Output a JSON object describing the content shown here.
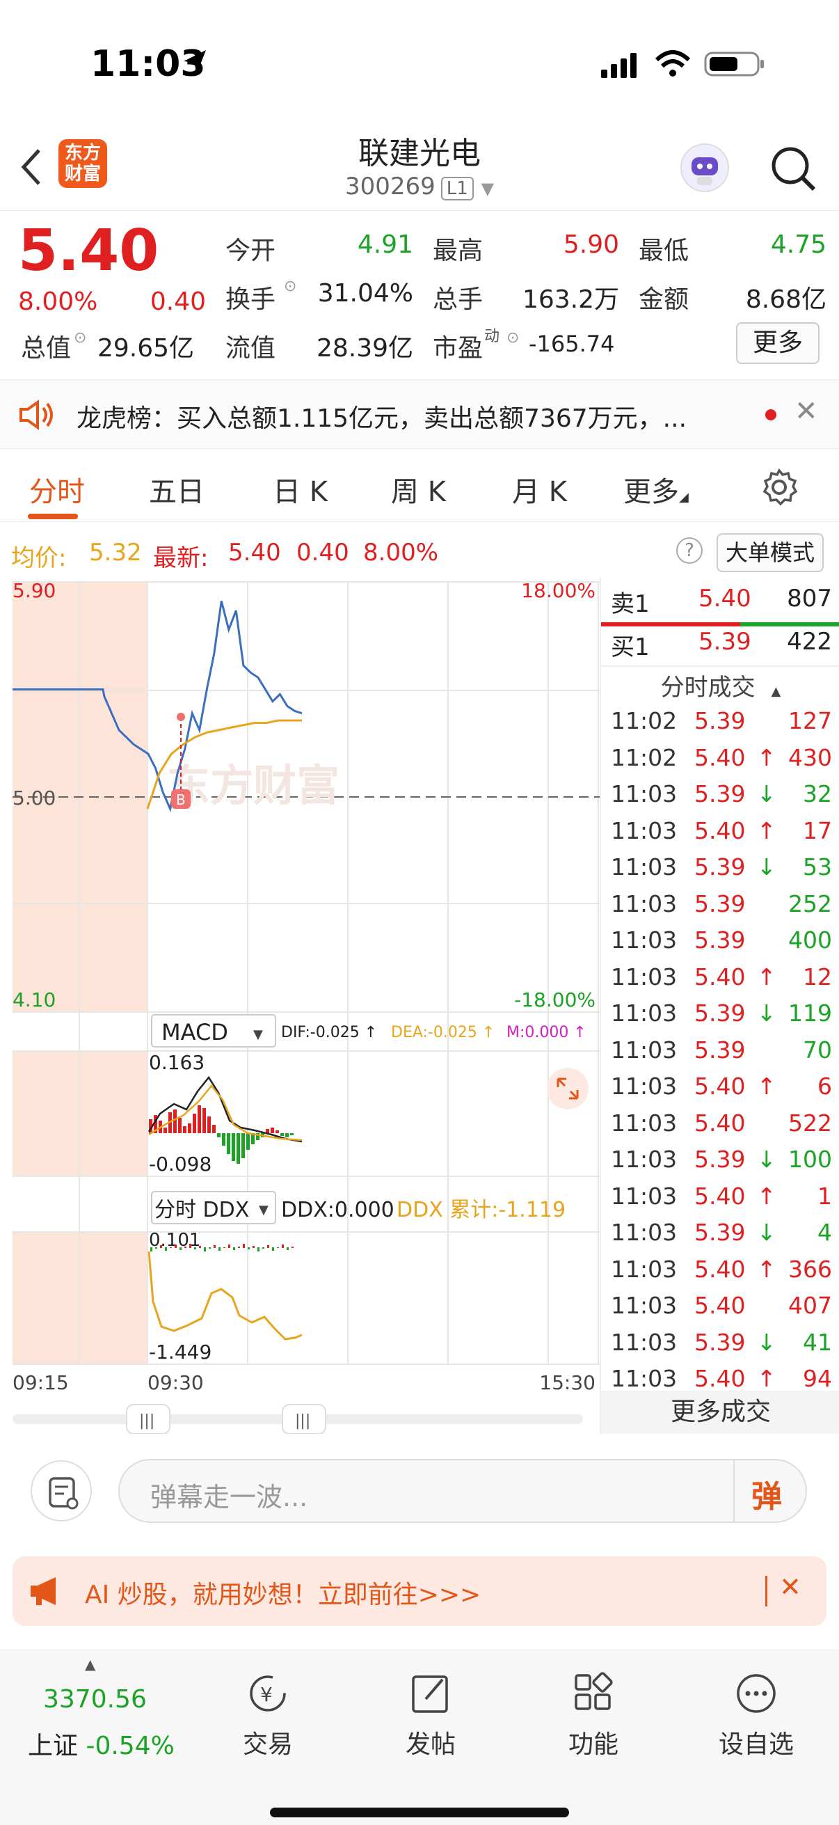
{
  "status_bar": {
    "time": "11:03"
  },
  "header": {
    "title": "联建光电",
    "code": "300269",
    "level": "L1",
    "logo_text": "东方财富"
  },
  "quote": {
    "price": "5.40",
    "change_pct": "8.00%",
    "change": "0.40",
    "open_label": "今开",
    "open": "4.91",
    "high_label": "最高",
    "high": "5.90",
    "low_label": "最低",
    "low": "4.75",
    "turnover_label": "换手",
    "turnover": "31.04%",
    "volume_label": "总手",
    "volume": "163.2万",
    "amount_label": "金额",
    "amount": "8.68亿",
    "mktcap_label": "总值",
    "mktcap": "29.65亿",
    "float_label": "流值",
    "float": "28.39亿",
    "pe_label": "市盈",
    "pe_sup": "动",
    "pe": "-165.74",
    "more": "更多"
  },
  "notice": {
    "text": "龙虎榜：买入总额1.115亿元，卖出总额7367万元，..."
  },
  "tabs": [
    "分时",
    "五日",
    "日 K",
    "周 K",
    "月 K",
    "更多"
  ],
  "info_row": {
    "avg_label": "均价:",
    "avg": "5.32",
    "latest_label": "最新:",
    "latest": "5.40",
    "chg": "0.40",
    "pct": "8.00%",
    "big_order": "大单模式"
  },
  "chart_labels": {
    "ymax": "5.90",
    "ymid": "5.00",
    "ymin": "4.10",
    "pct_max": "18.00%",
    "pct_min": "-18.00%",
    "watermark": "东方财富",
    "macd_name": "MACD",
    "dif": "DIF:-0.025 ↑",
    "dea": "DEA:-0.025 ↑",
    "m": "M:0.000 ↑",
    "macd_max": "0.163",
    "macd_min": "-0.098",
    "ddx_name": "分时 DDX",
    "ddx": "DDX:0.000",
    "ddx_sum": "DDX 累计:-1.119",
    "ddx_max": "0.101",
    "ddx_min": "-1.449",
    "t_start": "09:15",
    "t_open": "09:30",
    "t_end": "15:30"
  },
  "order_book": {
    "sell": {
      "label": "卖1",
      "price": "5.40",
      "vol": "807"
    },
    "buy": {
      "label": "买1",
      "price": "5.39",
      "vol": "422"
    },
    "trades_title": "分时成交",
    "more": "更多成交"
  },
  "trades": [
    {
      "time": "11:02",
      "price": "5.39",
      "dir": "",
      "vol": "127",
      "color": "red"
    },
    {
      "time": "11:02",
      "price": "5.40",
      "dir": "↑",
      "vol": "430",
      "color": "red"
    },
    {
      "time": "11:03",
      "price": "5.39",
      "dir": "↓",
      "vol": "32",
      "color": "green"
    },
    {
      "time": "11:03",
      "price": "5.40",
      "dir": "↑",
      "vol": "17",
      "color": "red"
    },
    {
      "time": "11:03",
      "price": "5.39",
      "dir": "↓",
      "vol": "53",
      "color": "green"
    },
    {
      "time": "11:03",
      "price": "5.39",
      "dir": "",
      "vol": "252",
      "color": "green"
    },
    {
      "time": "11:03",
      "price": "5.39",
      "dir": "",
      "vol": "400",
      "color": "green"
    },
    {
      "time": "11:03",
      "price": "5.40",
      "dir": "↑",
      "vol": "12",
      "color": "red"
    },
    {
      "time": "11:03",
      "price": "5.39",
      "dir": "↓",
      "vol": "119",
      "color": "green"
    },
    {
      "time": "11:03",
      "price": "5.39",
      "dir": "",
      "vol": "70",
      "color": "green"
    },
    {
      "time": "11:03",
      "price": "5.40",
      "dir": "↑",
      "vol": "6",
      "color": "red"
    },
    {
      "time": "11:03",
      "price": "5.40",
      "dir": "",
      "vol": "522",
      "color": "red"
    },
    {
      "time": "11:03",
      "price": "5.39",
      "dir": "↓",
      "vol": "100",
      "color": "green"
    },
    {
      "time": "11:03",
      "price": "5.40",
      "dir": "↑",
      "vol": "1",
      "color": "red"
    },
    {
      "time": "11:03",
      "price": "5.39",
      "dir": "↓",
      "vol": "4",
      "color": "green"
    },
    {
      "time": "11:03",
      "price": "5.40",
      "dir": "↑",
      "vol": "366",
      "color": "red"
    },
    {
      "time": "11:03",
      "price": "5.40",
      "dir": "",
      "vol": "407",
      "color": "red"
    },
    {
      "time": "11:03",
      "price": "5.39",
      "dir": "↓",
      "vol": "41",
      "color": "green"
    },
    {
      "time": "11:03",
      "price": "5.40",
      "dir": "↑",
      "vol": "94",
      "color": "red"
    }
  ],
  "comment": {
    "placeholder": "弹幕走一波...",
    "danmu": "弹"
  },
  "ad": {
    "text": "AI 炒股，就用妙想！立即前往>>>"
  },
  "bottom_nav": {
    "index_value": "3370.56",
    "index_name": "上证",
    "index_pct": "-0.54%",
    "trade": "交易",
    "post": "发帖",
    "func": "功能",
    "watch": "设自选"
  },
  "chart_data": {
    "type": "line",
    "title": "",
    "xlabel": "",
    "ylabel": "",
    "ylim": [
      4.1,
      5.9
    ],
    "x_range": [
      "09:15",
      "15:30"
    ],
    "series": [
      {
        "name": "",
        "color": "#3a6fc0",
        "values": [
          5.45,
          5.45,
          5.45,
          5.45,
          5.45,
          5.45,
          5.42,
          5.35,
          5.28,
          5.25,
          5.22,
          5.2,
          5.18,
          5.12,
          5.02,
          4.95,
          5.1,
          5.2,
          5.35,
          5.28,
          5.45,
          5.6,
          5.82,
          5.7,
          5.78,
          5.55,
          5.52,
          5.5,
          5.45,
          5.4,
          5.43,
          5.38,
          5.36,
          5.35
        ]
      },
      {
        "name": "均价",
        "color": "#e8a41c",
        "values": [
          4.95,
          5.1,
          5.18,
          5.22,
          5.25,
          5.27,
          5.28,
          5.29,
          5.3,
          5.31,
          5.31,
          5.32,
          5.32,
          5.32
        ]
      }
    ]
  }
}
